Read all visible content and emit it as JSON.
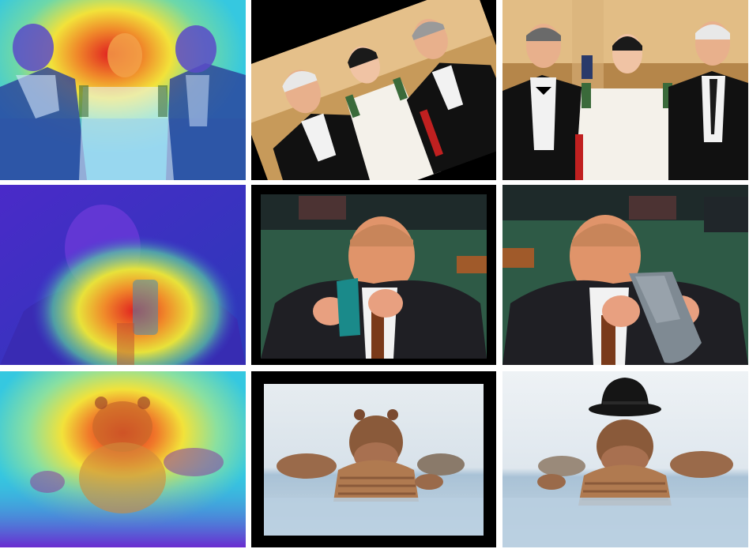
{
  "grid": {
    "rows": [
      {
        "subject": "three-people-at-gala",
        "panels": [
          "attention-heatmap",
          "rotated-photo",
          "edited-photo"
        ]
      },
      {
        "subject": "man-drinking-from-cup",
        "panels": [
          "attention-heatmap",
          "original-photo",
          "edited-photo"
        ]
      },
      {
        "subject": "hippo-in-water",
        "panels": [
          "attention-heatmap",
          "framed-photo",
          "edited-photo-with-hat"
        ]
      }
    ]
  },
  "colors": {
    "heat_red": "#e02020",
    "heat_yellow": "#f2e23a",
    "heat_cyan": "#35c8e0",
    "heat_blue": "#3a4fd0",
    "heat_purple": "#6a2ad0",
    "tux_black": "#111111",
    "dress_white": "#f4f1ea",
    "skin": "#e8b08c",
    "cup_teal": "#1a8a8a",
    "cup_grey": "#7f8a93",
    "water_blue": "#b9cfe0",
    "hippo_brown": "#8a5a3a",
    "hat_black": "#151515"
  }
}
